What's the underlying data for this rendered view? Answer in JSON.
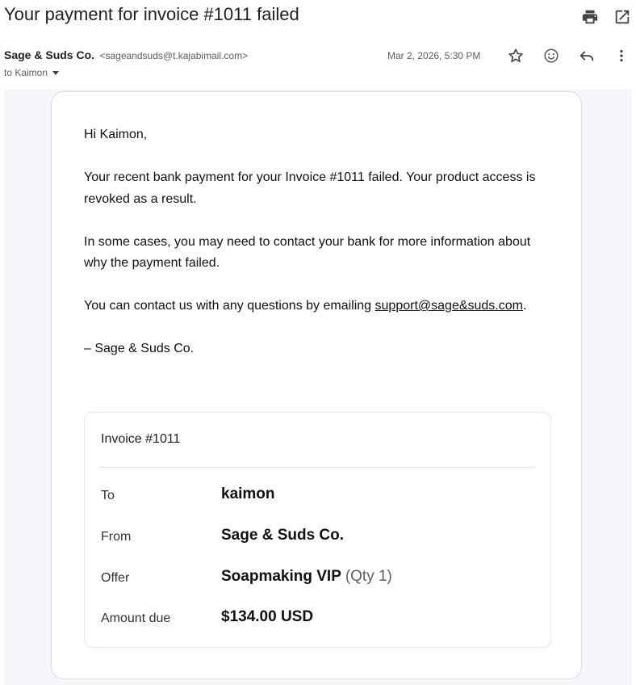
{
  "email": {
    "subject": "Your payment for invoice #1011 failed",
    "sender_name": "Sage & Suds Co.",
    "sender_email": "<sageandsuds@t.kajabimail.com>",
    "recipient": "to Kaimon",
    "date": "Mar 2, 2026, 5:30 PM"
  },
  "body": {
    "greeting": "Hi Kaimon,",
    "para1": "Your recent bank payment for your Invoice #1011 failed. Your product access is revoked as a result.",
    "para2": "In some cases, you may need to contact your bank for more information about why the payment failed.",
    "para3_prefix": "You can contact us with any questions by emailing",
    "support_email": "support@sage&suds.com",
    "para3_suffix": ".",
    "signature": "– Sage & Suds Co."
  },
  "invoice": {
    "title": "Invoice #1011",
    "rows": [
      {
        "label": "To",
        "value": "kaimon"
      },
      {
        "label": "From",
        "value": "Sage & Suds Co."
      },
      {
        "label": "Offer",
        "value": "Soapmaking VIP",
        "qty": "(Qty 1)"
      },
      {
        "label": "Amount due",
        "value": "$134.00 USD"
      }
    ]
  },
  "icons": {
    "print": "print-icon",
    "open_new_window": "open-in-new-window-icon",
    "star": "star-icon",
    "emoji": "emoji-reaction-icon",
    "reply": "reply-icon",
    "more": "more-vert-icon"
  },
  "colors": {
    "subject_text": "#202124",
    "secondary_text": "#5e5e5e",
    "mail_background": "#f5f6fa",
    "card_border": "#dadce0"
  }
}
